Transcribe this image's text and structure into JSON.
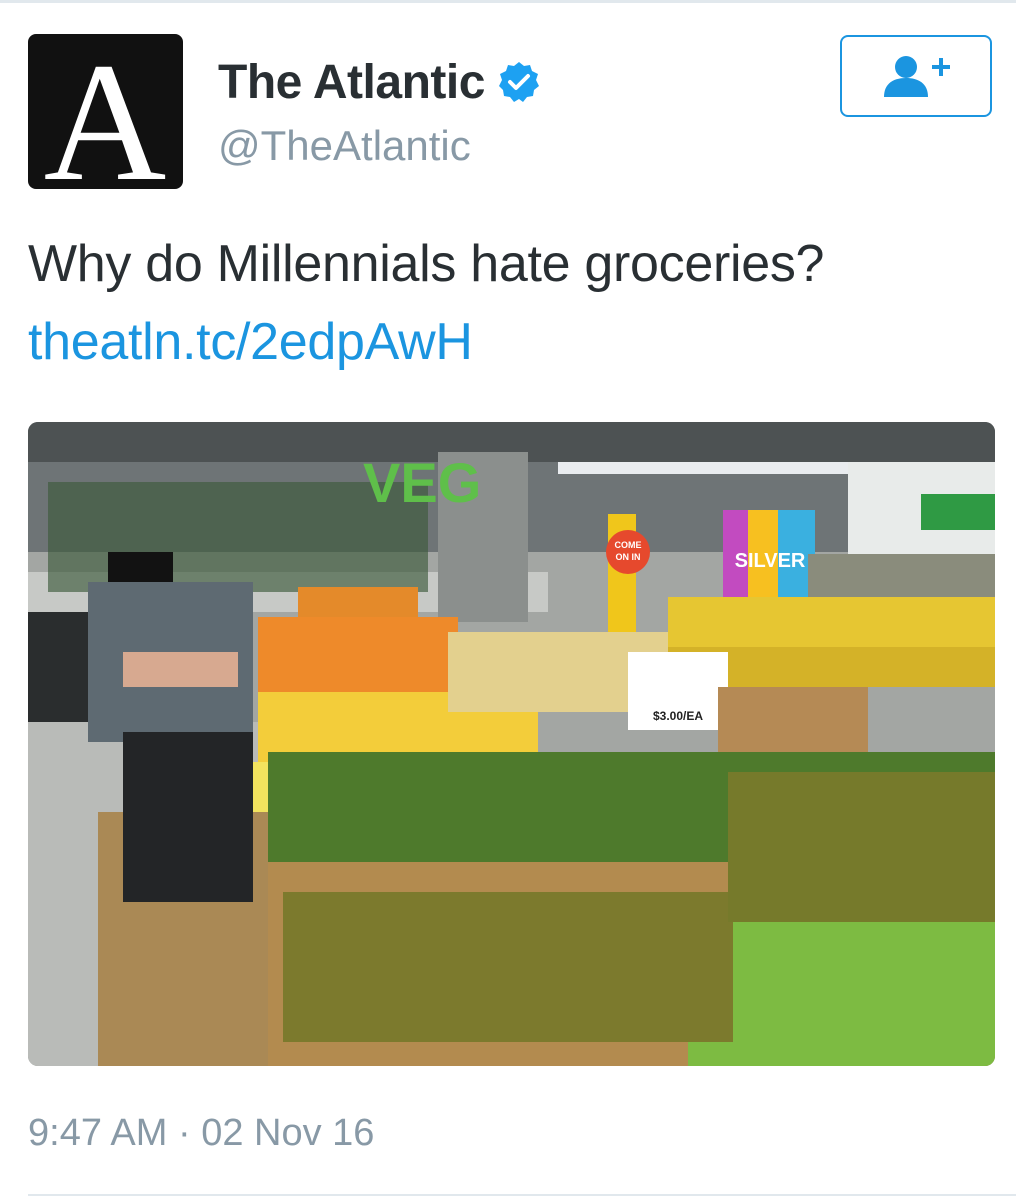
{
  "tweet": {
    "author": {
      "display_name": "The Atlantic",
      "handle": "@TheAtlantic",
      "avatar_letter": "A",
      "verified": true,
      "avatar_icon": "atlantic-logo-icon"
    },
    "follow_icon": "add-user-icon",
    "verified_icon": "verified-badge-icon",
    "text": "Why do Millennials hate groceries?",
    "link": "theatln.tc/2edpAwH",
    "media": {
      "description_icon": "grocery-photo",
      "signs": {
        "veg": "VEG",
        "come_on_in_1": "COME",
        "come_on_in_2": "ON IN",
        "banner": "SILVER",
        "price": "$3.00/EA"
      }
    },
    "timestamp": "9:47 AM · 02 Nov 16"
  },
  "colors": {
    "link": "#1b95e0",
    "text": "#292f33",
    "muted": "#8899a6",
    "verified": "#1da1f2"
  }
}
